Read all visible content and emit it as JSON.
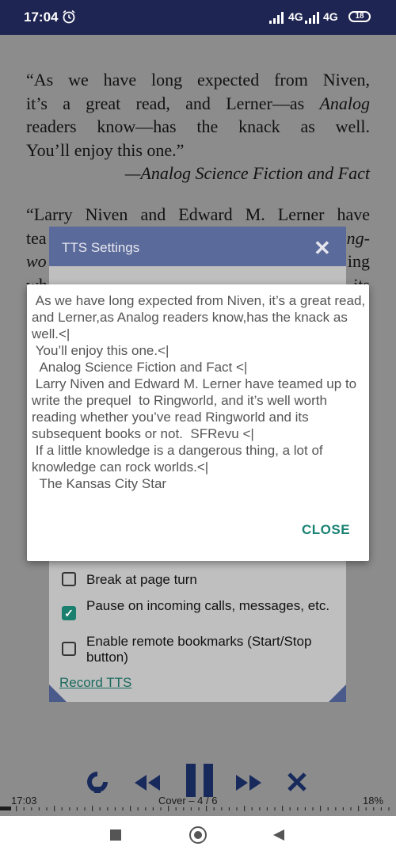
{
  "status_bar": {
    "time": "17:04",
    "network1": "4G",
    "network2": "4G",
    "battery": "18"
  },
  "reader": {
    "para1_line1": "“As we have long expected from Niven,",
    "para1_line2_a": "it’s a great read, and Lerner—as ",
    "para1_line2_b": "Analog",
    "para1_line3": "readers know—has the knack as well.",
    "para1_line4": "You’ll enjoy this one.”",
    "para1_attr": "—Analog Science Fiction and Fact",
    "para2_line1": "“Larry Niven and Edward M. Lerner have",
    "para2_line2_left": "tea",
    "para2_line2_right": "ng-",
    "para2_line3_left": "wo",
    "para2_line3_right": "ing",
    "para2_line4_left": "wh",
    "para2_line4_right": "its"
  },
  "tts_panel": {
    "title": "TTS Settings",
    "options": [
      {
        "label": "Break at page turn",
        "checked": false
      },
      {
        "label": "Pause on incoming calls, messages, etc.",
        "checked": true
      },
      {
        "label": "Enable remote bookmarks (Start/Stop button)",
        "checked": false
      }
    ],
    "record_link": "Record TTS"
  },
  "dialog": {
    "text": " As we have long expected from Niven, it’s a great read, and Lerner,as Analog readers know,has the knack as well.<|\n You’ll enjoy this one.<|\n  Analog Science Fiction and Fact <|\n Larry Niven and Edward M. Lerner have teamed up to write the prequel  to Ringworld, and it’s well worth reading whether you’ve read Ringworld and its subsequent books or not.  SFRevu <|\n If a little knowledge is a dangerous thing, a lot of knowledge can rock worlds.<|\n  The Kansas City Star",
    "close_label": "CLOSE"
  },
  "footer": {
    "time": "17:03",
    "chapter": "Cover – 4 / 6",
    "percent": "18%"
  },
  "colors": {
    "status_bar": "#1f2552",
    "accent": "#1a8273",
    "toolbar_icon": "#2a4ea6"
  }
}
